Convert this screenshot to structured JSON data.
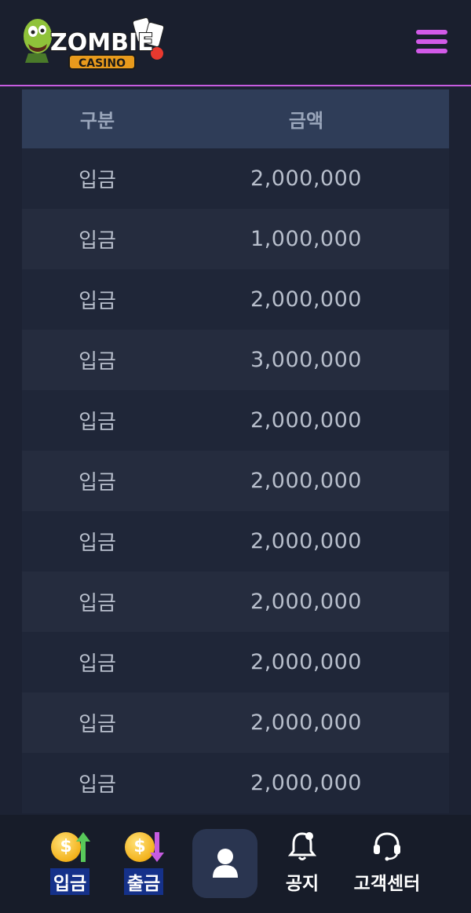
{
  "header": {
    "logo_text": "ZOMBIE",
    "logo_subtext": "CASINO"
  },
  "table": {
    "headers": [
      "구분",
      "금액"
    ],
    "rows": [
      {
        "type": "입금",
        "amount": "2,000,000"
      },
      {
        "type": "입금",
        "amount": "1,000,000"
      },
      {
        "type": "입금",
        "amount": "2,000,000"
      },
      {
        "type": "입금",
        "amount": "3,000,000"
      },
      {
        "type": "입금",
        "amount": "2,000,000"
      },
      {
        "type": "입금",
        "amount": "2,000,000"
      },
      {
        "type": "입금",
        "amount": "2,000,000"
      },
      {
        "type": "입금",
        "amount": "2,000,000"
      },
      {
        "type": "입금",
        "amount": "2,000,000"
      },
      {
        "type": "입금",
        "amount": "2,000,000"
      },
      {
        "type": "입금",
        "amount": "2,000,000"
      }
    ]
  },
  "bottom_nav": {
    "deposit_label": "입금",
    "withdraw_label": "출금",
    "notice_label": "공지",
    "support_label": "고객센터",
    "coin_symbol": "$"
  },
  "colors": {
    "accent": "#d25ae8",
    "background": "#1c2233",
    "header_row": "#2f3d58",
    "coin": "#f3b21c",
    "deposit_arrow": "#58c95a",
    "withdraw_arrow": "#c65ce0",
    "label_highlight": "#15318a"
  },
  "icons": {
    "menu": "hamburger-icon",
    "deposit": "coin-arrow-up-icon",
    "withdraw": "coin-arrow-down-icon",
    "profile": "user-icon",
    "notice": "bell-icon",
    "support": "headset-icon"
  }
}
